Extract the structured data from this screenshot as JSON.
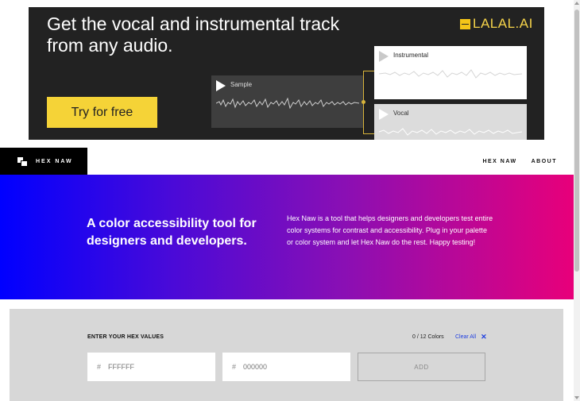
{
  "ad": {
    "headline": "Get the vocal and instrumental track from any audio.",
    "brand": "LALAL.AI",
    "cta": "Try for free",
    "sample_label": "Sample",
    "instrumental_label": "Instrumental",
    "vocal_label": "Vocal",
    "accent_color": "#f5d337"
  },
  "nav": {
    "brand": "HEX NAW",
    "links": [
      "HEX NAW",
      "ABOUT"
    ]
  },
  "hero": {
    "title": "A color accessibility tool for designers and developers.",
    "description": "Hex Naw is a tool that helps designers and developers test entire color systems for contrast and accessibility. Plug in your palette or color system and let Hex Naw do the rest. Happy testing!",
    "gradient": [
      "#0000ff",
      "#e8007a"
    ]
  },
  "form": {
    "label": "ENTER YOUR HEX VALUES",
    "count": "0 / 12 Colors",
    "clear_label": "Clear All",
    "clear_icon": "close-icon",
    "hash": "#",
    "field_1_placeholder": "FFFFFF",
    "field_2_placeholder": "000000",
    "add_label": "ADD"
  }
}
